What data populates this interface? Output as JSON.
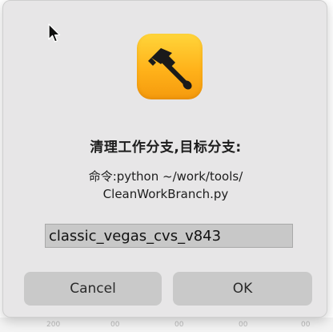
{
  "dialog": {
    "title": "清理工作分支,目标分支:",
    "command_line_1": "命令:python ~/work/tools/",
    "command_line_2": "CleanWorkBranch.py",
    "input_value": "classic_vegas_cvs_v843",
    "cancel_label": "Cancel",
    "ok_label": "OK",
    "app_icon": "hammer-icon"
  },
  "colors": {
    "dialog_bg": "#e7e6e7",
    "button_bg": "#c9c9c9",
    "input_bg": "#c8c8c8",
    "icon_gradient_top": "#ffd53a",
    "icon_gradient_bottom": "#f59a0d"
  }
}
